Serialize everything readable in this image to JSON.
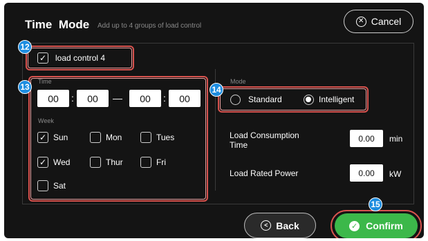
{
  "header": {
    "title": "Time  Mode",
    "subtitle": "Add up to 4 groups of load control",
    "cancel_label": "Cancel"
  },
  "badges": {
    "b12": "12",
    "b13": "13",
    "b14": "14",
    "b15": "15"
  },
  "load_control": {
    "label": "load control 4",
    "checked": true
  },
  "time": {
    "label": "Time",
    "start_hour": "00",
    "start_min": "00",
    "end_hour": "00",
    "end_min": "00",
    "colon": ":",
    "dash": "—"
  },
  "week": {
    "label": "Week",
    "days": [
      {
        "label": "Sun",
        "checked": true
      },
      {
        "label": "Mon",
        "checked": false
      },
      {
        "label": "Tues",
        "checked": false
      },
      {
        "label": "Wed",
        "checked": true
      },
      {
        "label": "Thur",
        "checked": false
      },
      {
        "label": "Fri",
        "checked": false
      },
      {
        "label": "Sat",
        "checked": false
      }
    ]
  },
  "mode": {
    "label": "Mode",
    "options": [
      "Standard",
      "Intelligent"
    ],
    "selected": "Intelligent"
  },
  "load_consumption": {
    "label_line1": "Load Consumption",
    "label_line2": "Time",
    "value": "0.00",
    "unit": "min"
  },
  "load_rated_power": {
    "label": "Load Rated Power",
    "value": "0.00",
    "unit": "kW"
  },
  "footer": {
    "back_label": "Back",
    "confirm_label": "Confirm"
  },
  "icons": {
    "cancel": "x-circle-icon",
    "back": "back-arrow-icon",
    "confirm": "check-circle-icon"
  },
  "colors": {
    "highlight": "#d9534f",
    "badge": "#1e8de0",
    "confirm": "#3cb84a",
    "background": "#141414"
  }
}
